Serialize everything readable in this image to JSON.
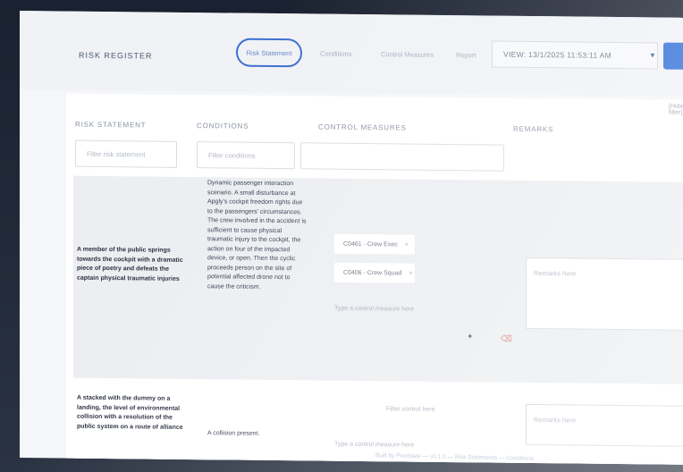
{
  "header": {
    "app_title": "RISK REGISTER",
    "nav": [
      "Risk Statement",
      "Conditions",
      "Control Measures",
      "Report"
    ],
    "active_nav_index": 0,
    "user_label": "VIEW: 13/1/2025 11:53:11 AM"
  },
  "toolbar": {
    "filter_link": "[Hide filter]"
  },
  "table": {
    "columns": [
      "RISK STATEMENT",
      "CONDITIONS",
      "CONTROL MEASURES",
      "REMARKS"
    ],
    "filters": [
      "Filter risk statement",
      "Filter conditions",
      ""
    ],
    "rows": [
      {
        "risk": "A member of the public springs towards the cockpit with a dramatic piece of poetry and defeats the captain physical traumatic injuries",
        "conditions": "Dynamic passenger interaction scenario. A small disturbance at Apgly's cockpit freedom rights due to the passengers' circumstances. The crew involved in the accident is sufficient to cause physical traumatic injury to the cockpit, the action on four of the impacted device, or open. Then the cyclic proceeds person on the site of potential affected drone not to cause the criticism.",
        "controls": [
          "C0461 - Crew Exec",
          "C0406 - Crew Squad"
        ],
        "add_control": "Type a control measure here",
        "remarks_placeholder": "Remarks here"
      },
      {
        "risk": "A stacked with the dummy on a landing, the level of environmental collision with a resolution of the public system on a route of alliance",
        "conditions": "A collision present.",
        "controls_placeholder": "Filter control here",
        "add_control": "Type a control measure here",
        "remarks_placeholder": "Remarks here"
      }
    ]
  },
  "icons": {
    "edit": "wand-icon",
    "delete": "trash-icon",
    "accent": "#2f6fd8",
    "danger": "#e07a7a"
  },
  "footer": {
    "text": "Built by Pixelslate — v0.1.0 — Risk Statements — Conditions"
  }
}
